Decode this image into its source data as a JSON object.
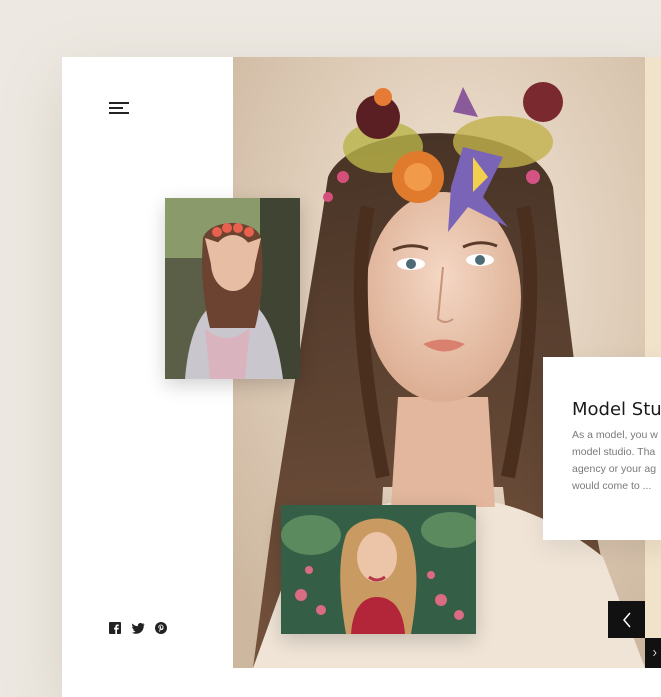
{
  "card": {
    "title": "Model Stu",
    "description_lines": [
      "As a model, you w",
      "model studio. Tha",
      "agency or your ag",
      "would come to ..."
    ]
  },
  "icons": {
    "menu": "hamburger-menu-icon",
    "prev": "chevron-left-icon",
    "next": "chevron-right-icon",
    "social": [
      "facebook-icon",
      "twitter-icon",
      "pinterest-icon"
    ]
  },
  "colors": {
    "background": "#ede9e2",
    "panel": "#ffffff",
    "dark": "#111111",
    "muted_text": "#7a7a7a"
  }
}
